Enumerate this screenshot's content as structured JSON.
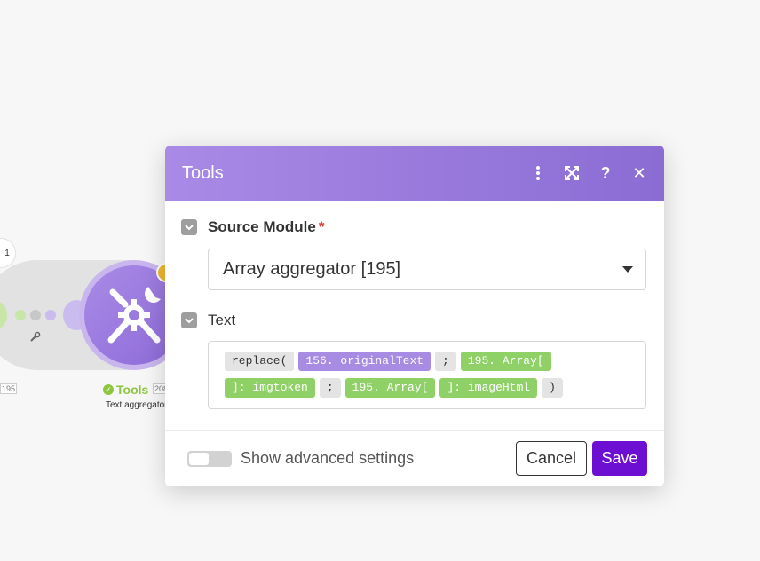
{
  "canvas": {
    "left_module_id": "195",
    "bubble_number": "1",
    "module": {
      "name": "Tools",
      "id": "208",
      "subtitle": "Text aggregator",
      "icon": "tools-icon"
    }
  },
  "dialog": {
    "title": "Tools",
    "header_icons": [
      "more-vertical-icon",
      "expand-icon",
      "help-icon",
      "close-icon"
    ],
    "help_glyph": "?",
    "close_glyph": "✕",
    "source_module": {
      "label": "Source Module",
      "required_marker": "*",
      "value": "Array aggregator [195]"
    },
    "text_field": {
      "label": "Text",
      "chips": [
        {
          "text": "replace(",
          "kind": "fn"
        },
        {
          "text": "156. originalText",
          "kind": "purple"
        },
        {
          "text": ";",
          "kind": "fn"
        },
        {
          "text": "195. Array[",
          "kind": "green"
        },
        {
          "text": "]: imgtoken",
          "kind": "green"
        },
        {
          "text": ";",
          "kind": "fn"
        },
        {
          "text": "195. Array[",
          "kind": "green"
        },
        {
          "text": "]: imageHtml",
          "kind": "green"
        },
        {
          "text": ")",
          "kind": "fn"
        }
      ]
    },
    "footer": {
      "advanced_label": "Show advanced settings",
      "advanced_enabled": false,
      "cancel_label": "Cancel",
      "save_label": "Save"
    }
  },
  "colors": {
    "header_start": "#a98ae6",
    "header_end": "#8b6cd3",
    "save_button": "#6c0fd3",
    "chip_purple": "#a88ce4",
    "chip_green": "#8fd067",
    "status_green": "#8ec63f"
  }
}
